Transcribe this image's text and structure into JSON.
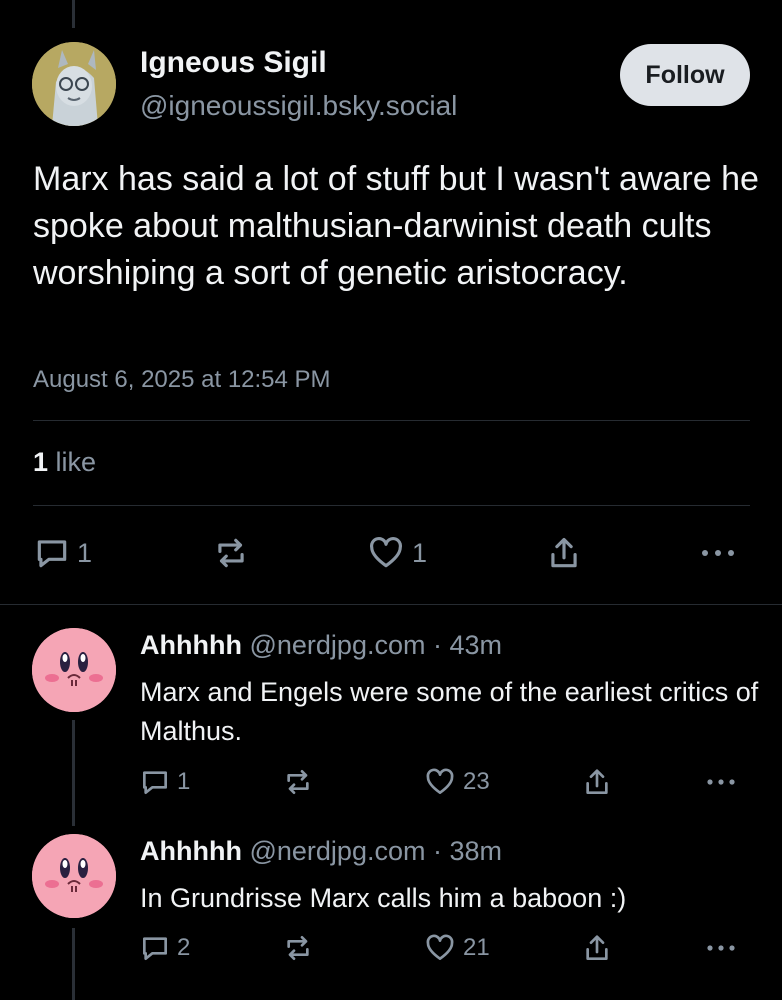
{
  "post": {
    "author_name": "Igneous Sigil",
    "author_handle": "@igneoussigil.bsky.social",
    "follow_label": "Follow",
    "text": "Marx has said a lot of stuff but I wasn't aware he spoke about malthusian-darwinist death cults worshiping a sort of genetic aristocracy.",
    "timestamp": "August 6, 2025 at 12:54 PM",
    "likes_count": "1",
    "likes_label": "like",
    "actions": {
      "reply_count": "1",
      "repost_count": "",
      "like_count": "1"
    }
  },
  "replies": [
    {
      "name": "Ahhhhh",
      "handle": "@nerdjpg.com",
      "separator": "·",
      "time": "43m",
      "text": "Marx and Engels were some of the earliest critics of Malthus.",
      "reply_count": "1",
      "like_count": "23"
    },
    {
      "name": "Ahhhhh",
      "handle": "@nerdjpg.com",
      "separator": "·",
      "time": "38m",
      "text": "In Grundrisse Marx calls him a baboon :)",
      "reply_count": "2",
      "like_count": "21"
    }
  ],
  "icons": [
    "reply-icon",
    "repost-icon",
    "like-icon",
    "share-icon",
    "more-icon"
  ],
  "colors": {
    "background": "#000000",
    "text": "#f1f3f5",
    "muted": "#8a96a3",
    "follow_bg": "#dfe3e8"
  }
}
